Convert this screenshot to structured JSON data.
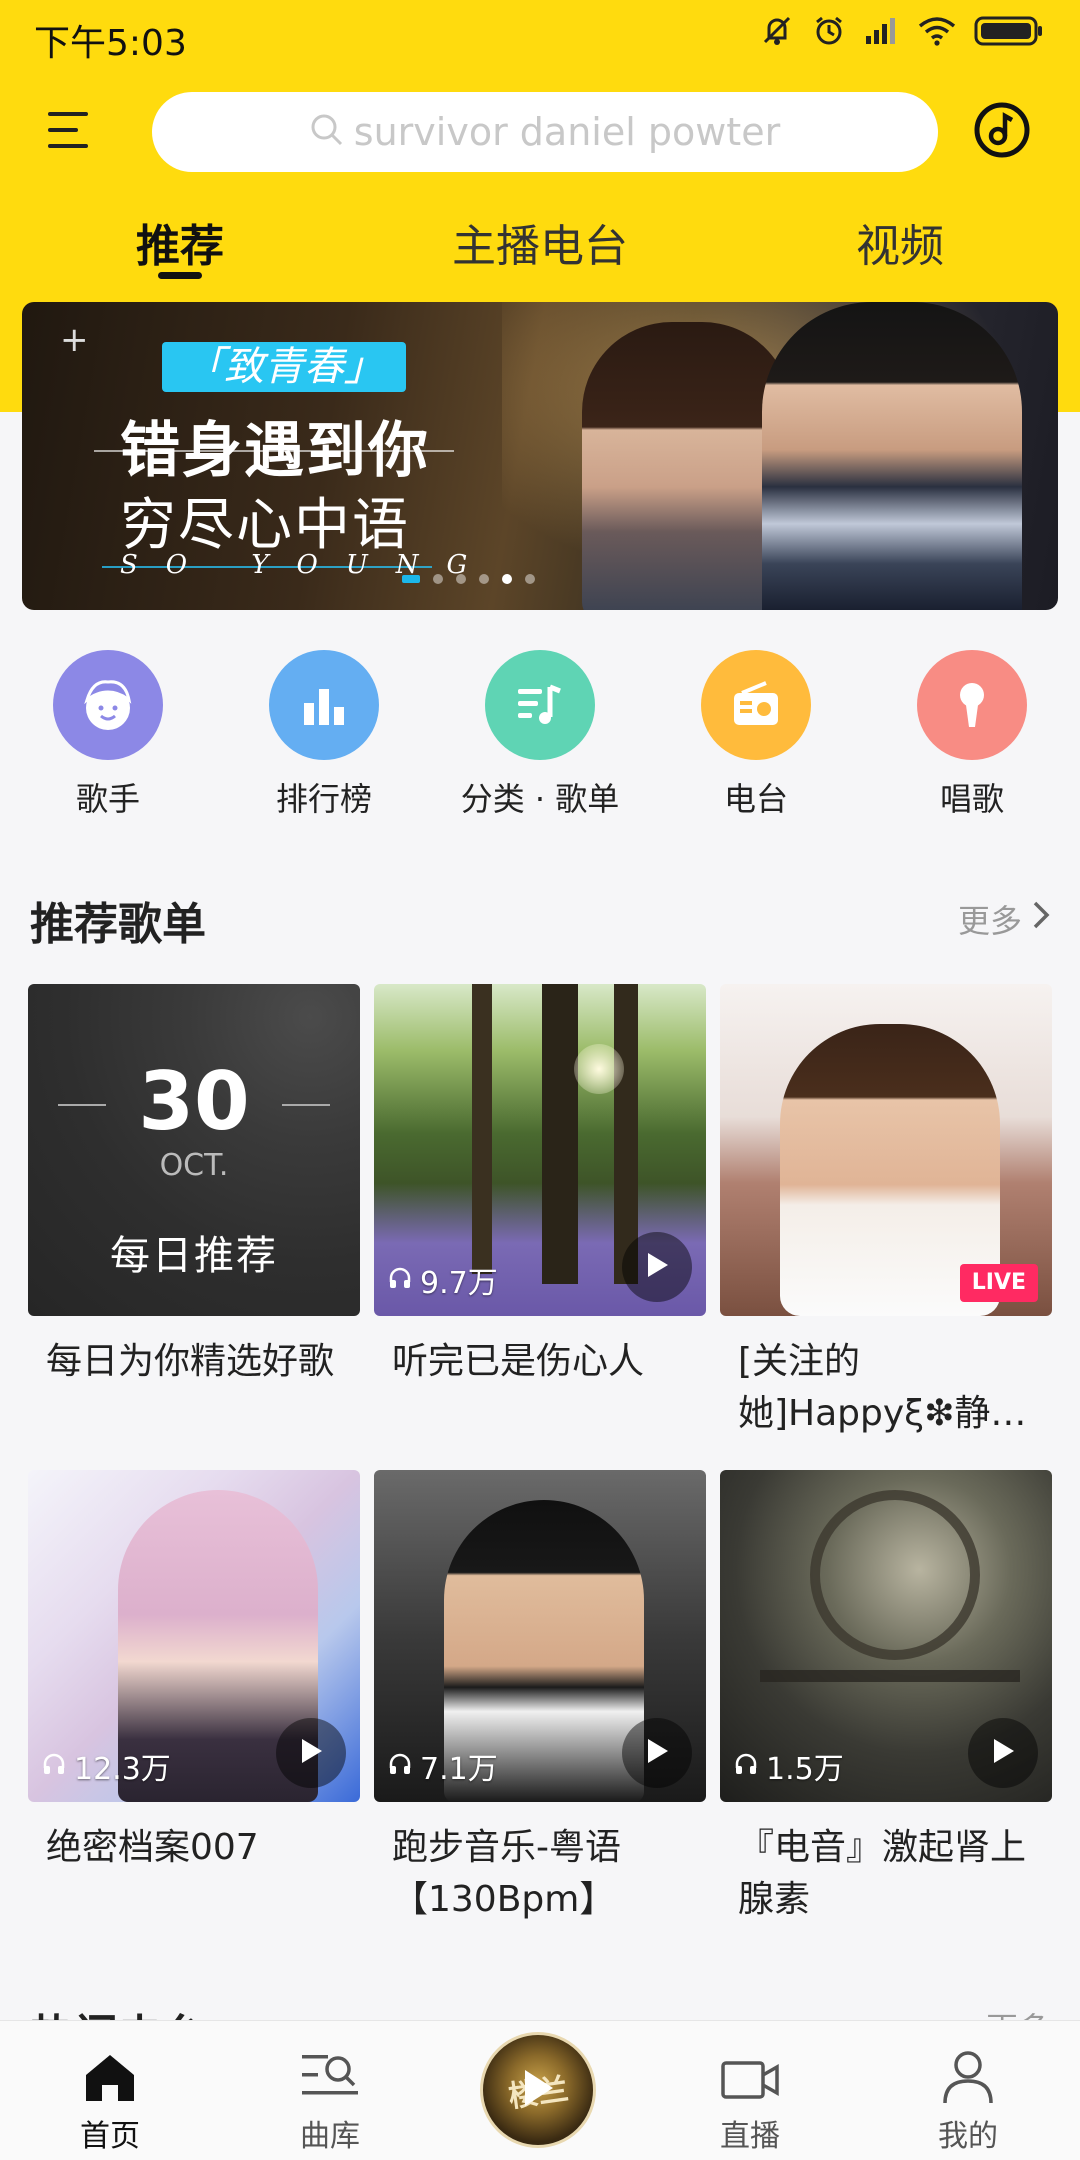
{
  "status": {
    "time": "下午5:03"
  },
  "search": {
    "placeholder": "survivor  daniel powter"
  },
  "tabs": [
    {
      "label": "推荐",
      "active": true
    },
    {
      "label": "主播电台",
      "active": false
    },
    {
      "label": "视频",
      "active": false
    }
  ],
  "banner": {
    "tag": "「致青春」",
    "title1": "错身遇到你",
    "title2": "穷尽心中语",
    "subtitle": "SO YOUNG",
    "dot_count": 6,
    "active_dot": 4
  },
  "quick_links": [
    {
      "label": "歌手",
      "icon": "singer-icon",
      "color": "#8c88e6"
    },
    {
      "label": "排行榜",
      "icon": "chart-icon",
      "color": "#64aef2"
    },
    {
      "label": "分类 · 歌单",
      "icon": "playlist-icon",
      "color": "#5fd4b4"
    },
    {
      "label": "电台",
      "icon": "radio-icon",
      "color": "#ffbb3c"
    },
    {
      "label": "唱歌",
      "icon": "microphone-icon",
      "color": "#f88c84"
    }
  ],
  "recommended": {
    "title": "推荐歌单",
    "more": "更多",
    "daily": {
      "day": "30",
      "month": "OCT.",
      "label": "每日推荐"
    },
    "cards": [
      {
        "title": "每日为你精选好歌",
        "count": ""
      },
      {
        "title": "听完已是伤心人",
        "count": "9.7万"
      },
      {
        "title": "[关注的她]Happyξ❇静…",
        "count": "",
        "badge": "LIVE"
      },
      {
        "title": "绝密档案007",
        "count": "12.3万"
      },
      {
        "title": "跑步音乐-粤语【130Bpm】",
        "count": "7.1万"
      },
      {
        "title": "『电音』激起肾上腺素",
        "count": "1.5万"
      }
    ]
  },
  "next_section": {
    "title": "热门电台",
    "more": "更多"
  },
  "bottom_nav": [
    {
      "label": "首页",
      "icon": "home-icon",
      "active": true
    },
    {
      "label": "曲库",
      "icon": "library-icon",
      "active": false
    },
    {
      "label": "直播",
      "icon": "live-camera-icon",
      "active": false
    },
    {
      "label": "我的",
      "icon": "profile-icon",
      "active": false
    }
  ],
  "now_playing": {
    "disc_text": "楼兰"
  },
  "colors": {
    "brand_yellow": "#ffdb0e",
    "accent_blue": "#1cb7ea",
    "live_pink": "#ff2a62"
  }
}
